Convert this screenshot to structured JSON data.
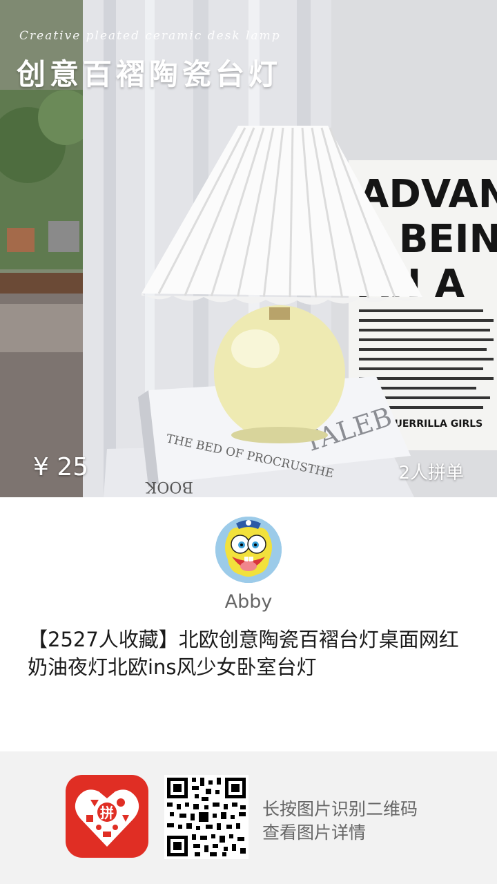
{
  "hero": {
    "subtitle_en": "Creative pleated ceramic desk lamp",
    "title_cn": "创意百褶陶瓷台灯",
    "price": "¥ 25",
    "group_buy": "2人拼单",
    "poster_text": "ADVANT\nE BEIN\nAN A",
    "book_text": "THE BED OF PROCRUSTHE",
    "book_text2": "TALEB",
    "book_text3": "BOOK",
    "poster_footer": "GUERRILLA GIRLS"
  },
  "sharer": {
    "username": "Abby",
    "avatar_icon": "spongebob-avatar"
  },
  "product": {
    "title": "【2527人收藏】北欧创意陶瓷百褶台灯桌面网红奶油夜灯北欧ins风少女卧室台灯"
  },
  "footer": {
    "app_icon": "pinduoduo-logo-icon",
    "app_logo_text": "拼",
    "qr_icon": "qr-code-icon",
    "hint_line1": "长按图片识别二维码",
    "hint_line2": "查看图片详情"
  },
  "colors": {
    "brand_red": "#e02e24",
    "footer_bg": "#f2f2f2",
    "hint_text": "#666666"
  }
}
